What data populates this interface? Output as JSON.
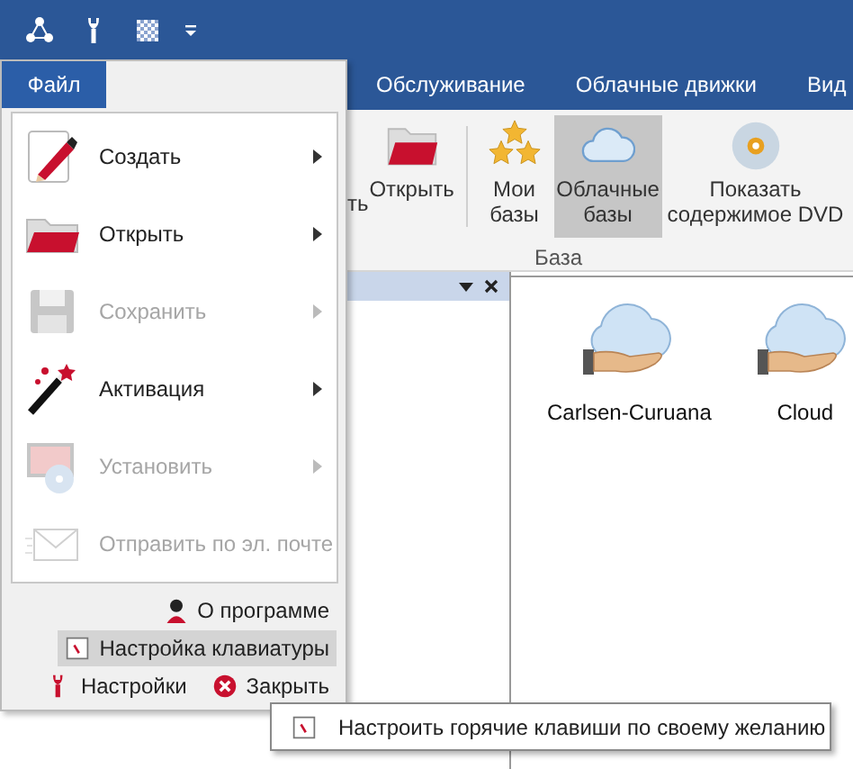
{
  "ribbon_tabs": [
    {
      "label": "Обслуживание",
      "selected": false
    },
    {
      "label": "Облачные движки",
      "selected": false
    },
    {
      "label": "Вид",
      "selected": false
    }
  ],
  "ribbon": {
    "buttons": [
      {
        "label": "ть",
        "selected": false
      },
      {
        "label": "Открыть",
        "selected": false
      },
      {
        "label": "Мои базы",
        "selected": false
      },
      {
        "label": "Облачные базы",
        "selected": true
      },
      {
        "label": "Показать содержимое DVD",
        "selected": false
      }
    ],
    "group_label": "База"
  },
  "content_items": [
    {
      "label": "Carlsen-Curuana"
    },
    {
      "label": "Cloud"
    }
  ],
  "file_menu": {
    "tab": "Файл",
    "items": [
      {
        "label": "Создать",
        "disabled": false,
        "submenu": true
      },
      {
        "label": "Открыть",
        "disabled": false,
        "submenu": true
      },
      {
        "label": "Сохранить",
        "disabled": true,
        "submenu": true
      },
      {
        "label": "Активация",
        "disabled": false,
        "submenu": true
      },
      {
        "label": "Установить",
        "disabled": true,
        "submenu": true
      },
      {
        "label": "Отправить по эл. почте",
        "disabled": true,
        "submenu": false
      }
    ],
    "footer_items": [
      {
        "label": "О программе",
        "selected": false
      },
      {
        "label": "Настройка клавиатуры",
        "selected": true
      },
      {
        "label": "Настройки",
        "selected": false
      },
      {
        "label": "Закрыть",
        "selected": false
      }
    ]
  },
  "tooltip": "Настроить горячие клавиши по своему желанию"
}
